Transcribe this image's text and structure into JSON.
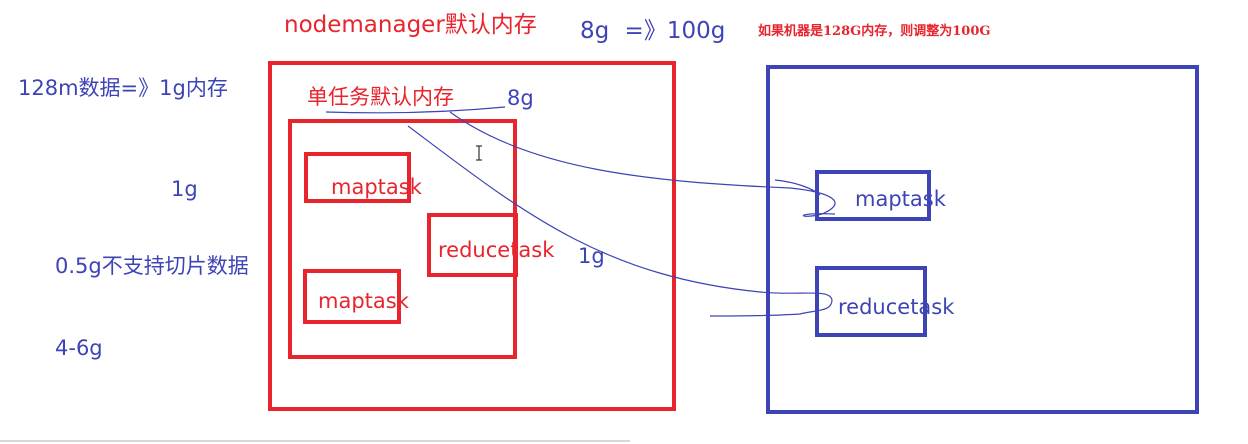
{
  "header": {
    "nodemanager_label": "nodemanager默认内存",
    "nodemanager_value": "8g =》100g",
    "note": "如果机器是128G内存，则调整为100G"
  },
  "left_notes": {
    "rule": "128m数据=》1g内存",
    "one_g": "1g",
    "half_g": "0.5g不支持切片数据",
    "range": "4-6g"
  },
  "left_node": {
    "single_task_label": "单任务默认内存",
    "single_task_value": "8g",
    "task1": "maptask",
    "task2": "reducetask",
    "task3": "maptask",
    "one_g_label": "1g"
  },
  "right_node": {
    "task1": "maptask",
    "task2": "reducetask"
  },
  "colors": {
    "red": "#e8242d",
    "blue": "#3d44b5"
  }
}
